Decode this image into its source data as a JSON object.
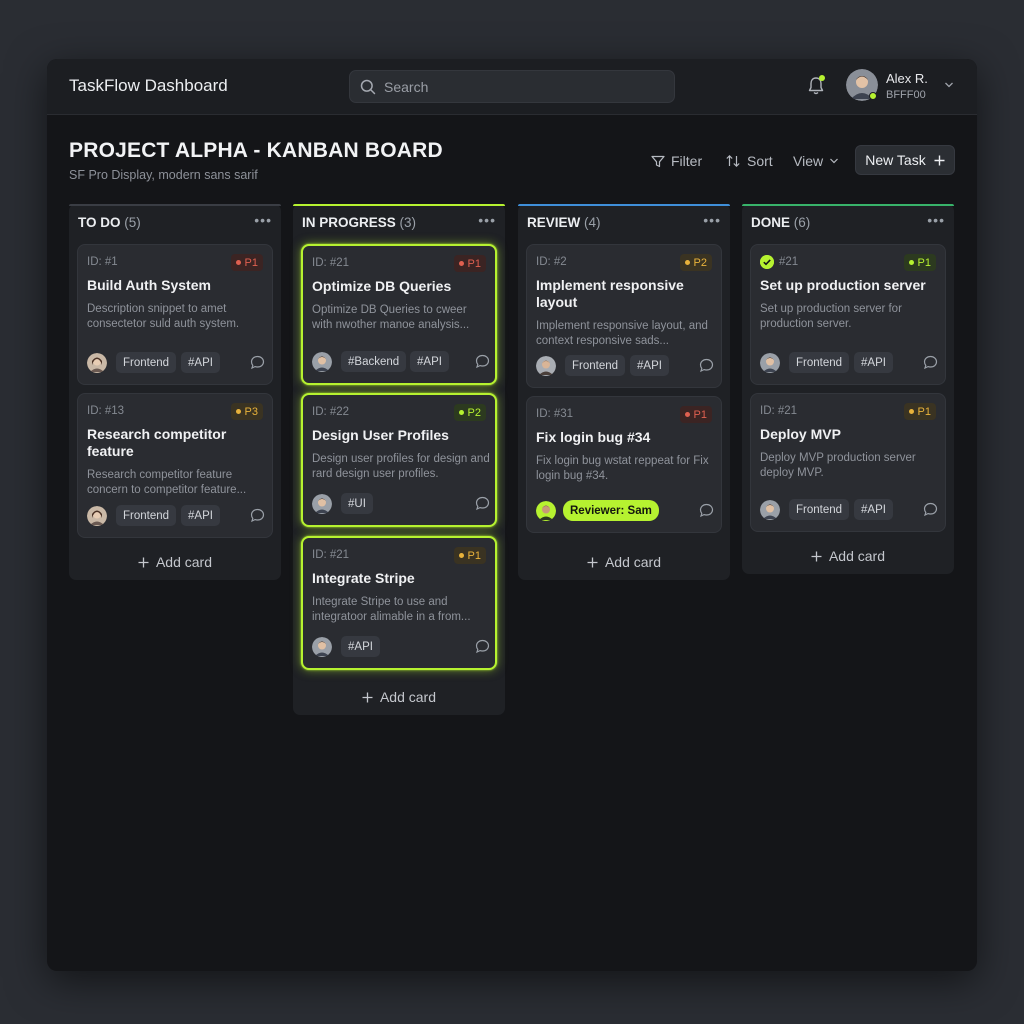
{
  "app": {
    "title": "TaskFlow Dashboard"
  },
  "search": {
    "placeholder": "Search"
  },
  "user": {
    "name": "Alex R.",
    "color_text": "BFFF00"
  },
  "board": {
    "title": "PROJECT ALPHA - KANBAN BOARD",
    "subtitle": "SF Pro Display, modern sans sarif"
  },
  "toolbar": {
    "filter": "Filter",
    "sort": "Sort",
    "view": "View",
    "new_task": "New Task"
  },
  "colors": {
    "accent": "#b6f230",
    "p1": "#e06050",
    "p2": "#e8b23b",
    "review_accent": "#3f8fd9",
    "done_accent": "#38b36a"
  },
  "columns": [
    {
      "name": "TO DO",
      "count": "(5)",
      "add_label": "Add card",
      "cards": [
        {
          "id": "ID: #1",
          "priority": "P1",
          "title": "Build Auth System",
          "desc": "Description snippet to amet consectetor suld auth system.",
          "tags": [
            "Frontend",
            "#API"
          ]
        },
        {
          "id": "ID: #13",
          "priority": "P3",
          "title": "Research competitor feature",
          "desc": "Research competitor feature concern to competitor feature...",
          "tags": [
            "Frontend",
            "#API"
          ]
        }
      ]
    },
    {
      "name": "IN PROGRESS",
      "count": "(3)",
      "add_label": "Add card",
      "cards": [
        {
          "id": "ID: #21",
          "priority": "P1",
          "title": "Optimize DB Queries",
          "desc": "Optimize DB Queries to cweer with nwother manoe analysis...",
          "tags": [
            "#Backend",
            "#API"
          ]
        },
        {
          "id": "ID: #22",
          "priority": "P2",
          "title": "Design User Profiles",
          "desc": "Design user profiles for design and rard design user profiles.",
          "tags": [
            "#UI"
          ]
        },
        {
          "id": "ID: #21",
          "priority": "P1",
          "title": "Integrate Stripe",
          "desc": "Integrate Stripe to use and integratoor alimable in a from...",
          "tags": [
            "#API"
          ]
        }
      ]
    },
    {
      "name": "REVIEW",
      "count": "(4)",
      "add_label": "Add card",
      "cards": [
        {
          "id": "ID: #2",
          "priority": "P2",
          "title": "Implement responsive layout",
          "desc": "Implement responsive layout, and context responsive sads...",
          "tags": [
            "Frontend",
            "#API"
          ]
        },
        {
          "id": "ID: #31",
          "priority": "P1",
          "title": "Fix login bug #34",
          "desc": "Fix login bug wstat reppeat for Fix login bug #34.",
          "tags": [
            "Reviewer: Sam"
          ]
        }
      ]
    },
    {
      "name": "DONE",
      "count": "(6)",
      "add_label": "Add card",
      "cards": [
        {
          "id": "#21",
          "priority": "P1",
          "title": "Set up production server",
          "desc": "Set up production server for production server.",
          "tags": [
            "Frontend",
            "#API"
          ]
        },
        {
          "id": "ID: #21",
          "priority": "P1",
          "title": "Deploy MVP",
          "desc": "Deploy MVP production server deploy MVP.",
          "tags": [
            "Frontend",
            "#API"
          ]
        }
      ]
    }
  ]
}
